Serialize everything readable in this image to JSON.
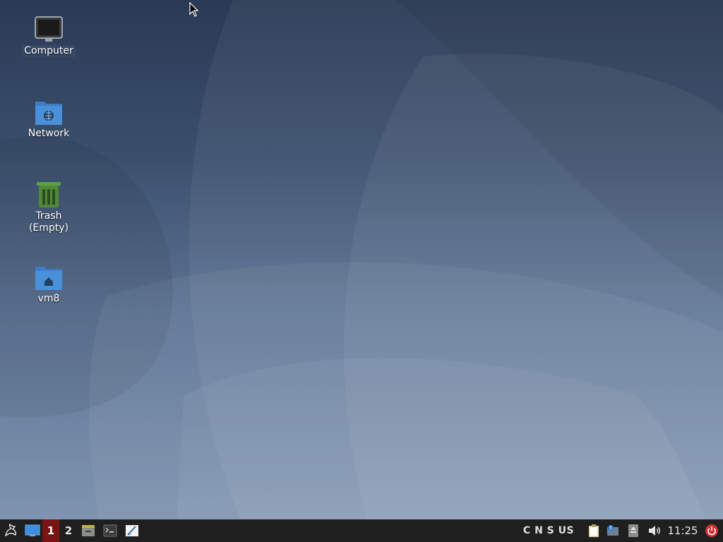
{
  "desktop": {
    "icons": [
      {
        "label": "Computer",
        "icon": "computer-icon"
      },
      {
        "label": "Network",
        "icon": "network-folder-icon"
      },
      {
        "label": "Trash",
        "sublabel": "(Empty)",
        "icon": "trash-icon"
      },
      {
        "label": "vm8",
        "icon": "home-folder-icon"
      }
    ]
  },
  "panel": {
    "workspaces": [
      "1",
      "2"
    ],
    "active_workspace": "1",
    "keyboard_indicators": "C N S US",
    "clock": "11:25",
    "launchers": [
      "whisker-menu-icon",
      "show-desktop-icon",
      "file-manager-icon",
      "terminal-icon",
      "text-editor-icon"
    ],
    "tray": [
      "clipboard-icon",
      "notification-icon",
      "removable-drive-icon",
      "volume-icon",
      "power-icon"
    ]
  },
  "colors": {
    "panel_bg": "#1f1f1f",
    "active_workspace": "#7a1414",
    "folder_blue": "#4a90d9",
    "trash_green": "#4f8a3a",
    "power_red": "#d32f2f"
  }
}
